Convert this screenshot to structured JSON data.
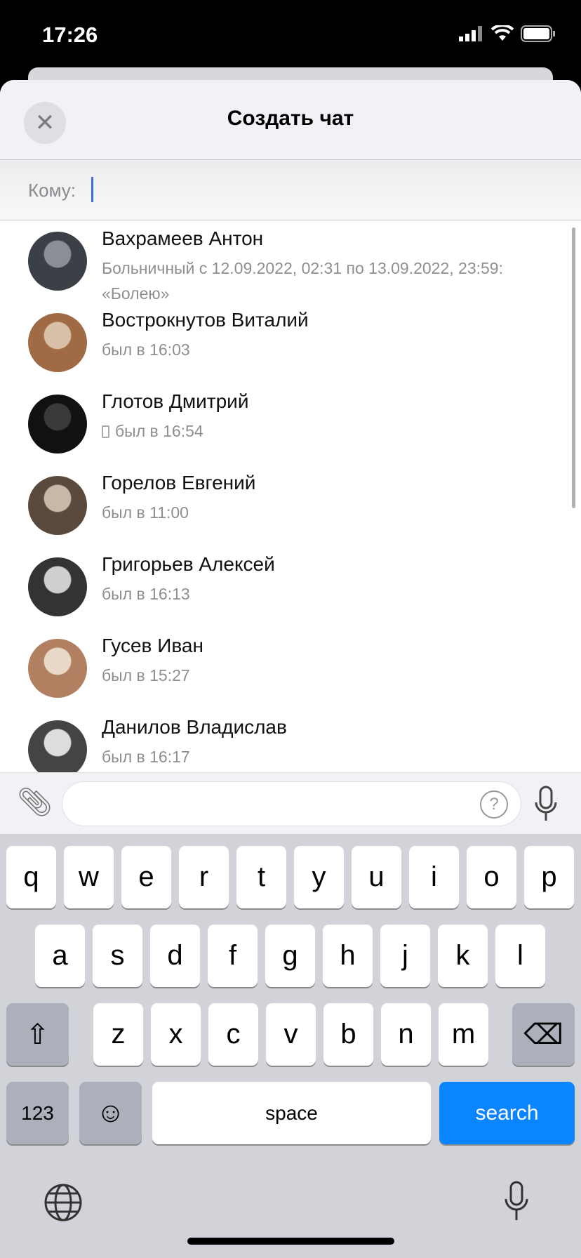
{
  "status_bar": {
    "time": "17:26"
  },
  "header": {
    "title": "Создать чат",
    "close_icon": "x-icon"
  },
  "recipient": {
    "label": "Кому:",
    "value": ""
  },
  "contacts": [
    {
      "name": "Вахрамеев Антон",
      "status": "Больничный с 12.09.2022, 02:31 по 13.09.2022, 23:59: «Болею»",
      "mobile": false
    },
    {
      "name": "Вострокнутов Виталий",
      "status": "был в 16:03",
      "mobile": false
    },
    {
      "name": "Глотов Дмитрий",
      "status": "был в 16:54",
      "mobile": true
    },
    {
      "name": "Горелов Евгений",
      "status": "был в 11:00",
      "mobile": false
    },
    {
      "name": "Григорьев Алексей",
      "status": "был в 16:13",
      "mobile": false
    },
    {
      "name": "Гусев Иван",
      "status": "был в 15:27",
      "mobile": false
    },
    {
      "name": "Данилов Владислав",
      "status": "был в 16:17",
      "mobile": false
    }
  ],
  "composer": {
    "placeholder": "",
    "help": "?"
  },
  "keyboard": {
    "row1": [
      "q",
      "w",
      "e",
      "r",
      "t",
      "y",
      "u",
      "i",
      "o",
      "p"
    ],
    "row2": [
      "a",
      "s",
      "d",
      "f",
      "g",
      "h",
      "j",
      "k",
      "l"
    ],
    "row3": [
      "z",
      "x",
      "c",
      "v",
      "b",
      "n",
      "m"
    ],
    "numbers": "123",
    "space": "space",
    "action": "search",
    "shift": "⇧",
    "delete": "⌫",
    "emoji": "☺"
  }
}
